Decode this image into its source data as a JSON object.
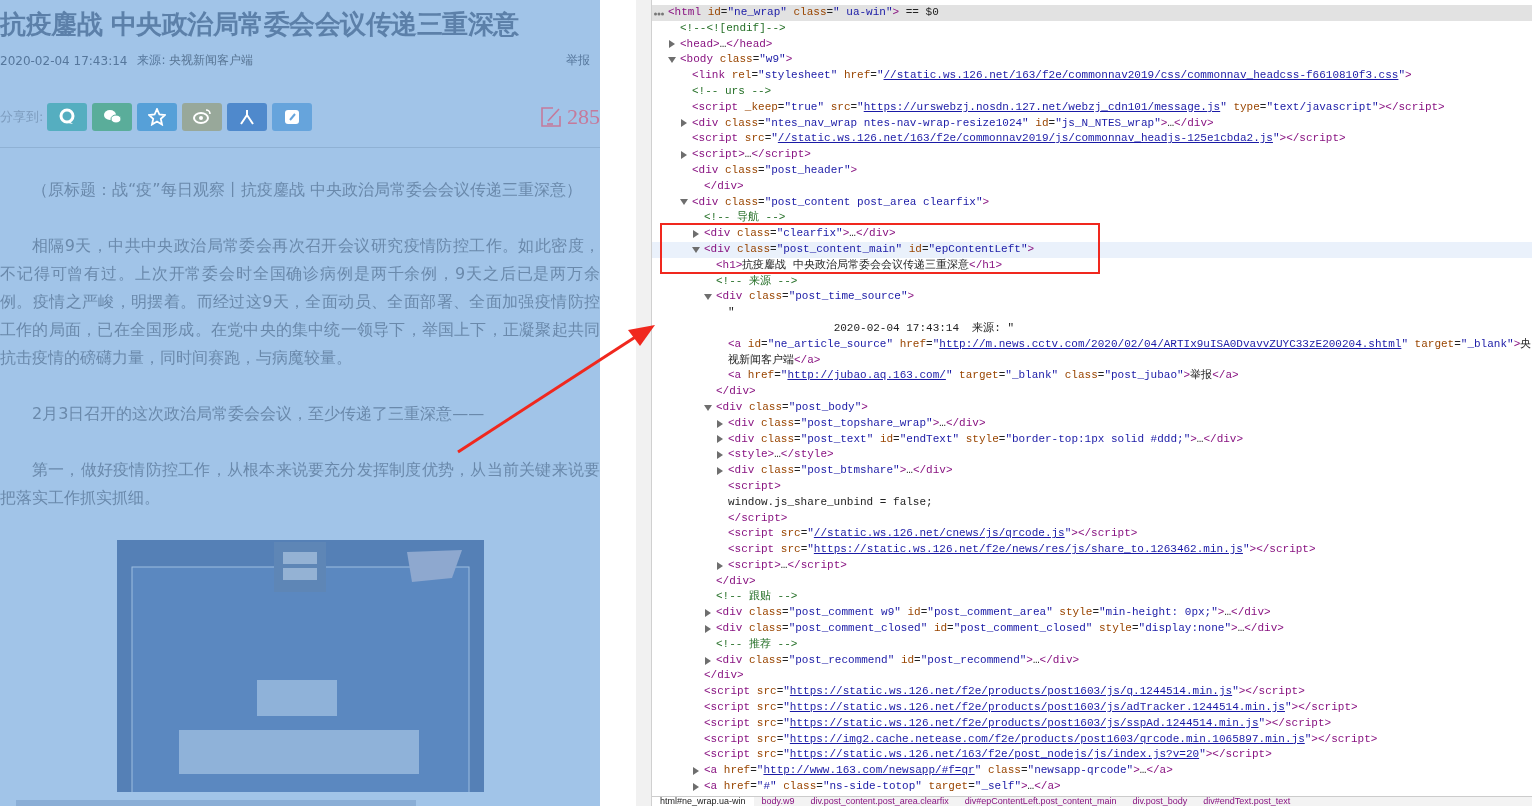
{
  "article": {
    "title": "抗疫鏖战 中央政治局常委会会议传递三重深意",
    "time": "2020-02-04 17:43:14",
    "source_label": "来源:",
    "source": "央视新闻客户端",
    "report": "举报",
    "share_label": "分享到:",
    "share_buttons": [
      {
        "kind": "qq",
        "color": "#55aec0"
      },
      {
        "kind": "wechat",
        "color": "#5aad9a"
      },
      {
        "kind": "qzone",
        "color": "#56a0d8"
      },
      {
        "kind": "weibo",
        "color": "#98a89a"
      },
      {
        "kind": "renren",
        "color": "#4f89cc"
      },
      {
        "kind": "note",
        "color": "#66a4dc"
      }
    ],
    "comment_count": "285",
    "paragraphs": [
      "（原标题：战“疫”每日观察丨抗疫鏖战 中央政治局常委会会议传递三重深意）",
      "相隔9天，中共中央政治局常委会再次召开会议研究疫情防控工作。如此密度，不记得可曾有过。上次开常委会时全国确诊病例是两千余例，9天之后已是两万余例。疫情之严峻，明摆着。而经过这9天，全面动员、全面部署、全面加强疫情防控工作的局面，已在全国形成。在党中央的集中统一领导下，举国上下，正凝聚起共同抗击疫情的磅礴力量，同时间赛跑，与病魔较量。",
      "2月3日召开的这次政治局常委会会议，至少传递了三重深意——",
      "第一，做好疫情防控工作，从根本来说要充分发挥制度优势，从当前关键来说要把落实工作抓实抓细。"
    ]
  },
  "devtools": {
    "tree": [
      {
        "line": "<html id=\"ne_wrap\" class=\" ua-win\"> == $0",
        "selected": true,
        "children": [
          {
            "line": "<!--<![endif]-->",
            "selected": false
          },
          {
            "line": "<head>…</head>",
            "selected": false,
            "expanded": false
          },
          {
            "line": "<body class=\"w9\">",
            "selected": false,
            "expanded": true,
            "children": [
              {
                "line": "<link rel=\"stylesheet\" href=\"//static.ws.126.net/163/f2e/commonnav2019/css/commonnav_headcss-f6610810f3.css\">",
                "selected": false
              },
              {
                "line": "<!-- urs -->",
                "selected": false
              },
              {
                "line": "<script _keep=\"true\" src=\"https://urswebzj.nosdn.127.net/webzj_cdn101/message.js\" type=\"text/javascript\"></script>",
                "selected": false
              },
              {
                "line": "<div class=\"ntes_nav_wrap ntes-nav-wrap-resize1024\" id=\"js_N_NTES_wrap\">…</div>",
                "selected": false,
                "expanded": false
              },
              {
                "line": "<script src=\"//static.ws.126.net/163/f2e/commonnav2019/js/commonnav_headjs-125e1cbda2.js\"></script>",
                "selected": false
              },
              {
                "line": "<script>…</script>",
                "selected": false,
                "expanded": false
              },
              {
                "line": "<div class=\"post_header\">",
                "selected": false,
                "children": [
                  {
                    "line": "</div>",
                    "selected": false
                  }
                ]
              },
              {
                "line": "<div class=\"post_content post_area clearfix\">",
                "selected": false,
                "expanded": true,
                "children": [
                  {
                    "line": "<!-- 导航 -->",
                    "selected": false
                  },
                  {
                    "line": "<div class=\"clearfix\">…</div>",
                    "selected": false,
                    "expanded": false
                  },
                  {
                    "line": "<div class=\"post_content_main\" id=\"epContentLeft\">",
                    "selected": false,
                    "hovered": true,
                    "expanded": true,
                    "close": "</div>",
                    "children": [
                      {
                        "line": "<h1>抗疫鏖战 中央政治局常委会会议传递三重深意</h1>",
                        "selected": false
                      },
                      {
                        "line": "<!-- 来源 -->",
                        "selected": false
                      },
                      {
                        "line": "<div class=\"post_time_source\">",
                        "selected": false,
                        "expanded": true,
                        "close": "</div>",
                        "children": [
                          {
                            "line": "\"\n                2020-02-04 17:43:14  来源: \"",
                            "selected": false
                          },
                          {
                            "line": "<a id=\"ne_article_source\" href=\"http://m.news.cctv.com/2020/02/04/ARTIx9uISA0DvavvZUYC33zE200204.shtml\" target=\"_blank\">央视新闻客户端</a>",
                            "selected": false
                          },
                          {
                            "line": "<a href=\"http://jubao.aq.163.com/\" target=\"_blank\" class=\"post_jubao\">举报</a>",
                            "selected": false
                          }
                        ]
                      },
                      {
                        "line": "<div class=\"post_body\">",
                        "selected": false,
                        "expanded": true,
                        "close": "</div>",
                        "children": [
                          {
                            "line": "<div class=\"post_topshare_wrap\">…</div>",
                            "selected": false,
                            "expanded": false
                          },
                          {
                            "line": "<div class=\"post_text\" id=\"endText\" style=\"border-top:1px solid #ddd;\">…</div>",
                            "selected": false,
                            "expanded": false
                          },
                          {
                            "line": "<style>…</style>",
                            "selected": false,
                            "expanded": false
                          },
                          {
                            "line": "<div class=\"post_btmshare\">…</div>",
                            "selected": false,
                            "expanded": false
                          },
                          {
                            "line": "<script>",
                            "selected": false
                          },
                          {
                            "line": "window.js_share_unbind = false;",
                            "selected": false
                          },
                          {
                            "line": "</script>",
                            "selected": false
                          },
                          {
                            "line": "<script src=\"//static.ws.126.net/cnews/js/qrcode.js\"></script>",
                            "selected": false
                          },
                          {
                            "line": "<script src=\"https://static.ws.126.net/f2e/news/res/js/share_to.1263462.min.js\"></script>",
                            "selected": false
                          },
                          {
                            "line": "<script>…</script>",
                            "selected": false,
                            "expanded": false
                          }
                        ]
                      },
                      {
                        "line": "<!-- 跟贴 -->",
                        "selected": false
                      },
                      {
                        "line": "<div class=\"post_comment w9\" id=\"post_comment_area\" style=\"min-height: 0px;\">…</div>",
                        "selected": false,
                        "expanded": false
                      },
                      {
                        "line": "<div class=\"post_comment_closed\" id=\"post_comment_closed\" style=\"display:none\">…</div>",
                        "selected": false,
                        "expanded": false
                      },
                      {
                        "line": "<!-- 推荐 -->",
                        "selected": false
                      },
                      {
                        "line": "<div class=\"post_recommend\" id=\"post_recommend\">…</div>",
                        "selected": false,
                        "expanded": false
                      }
                    ]
                  },
                  {
                    "line": "<script src=\"https://static.ws.126.net/f2e/products/post1603/js/q.1244514.min.js\"></script>",
                    "selected": false
                  },
                  {
                    "line": "<script src=\"https://static.ws.126.net/f2e/products/post1603/js/adTracker.1244514.min.js\"></script>",
                    "selected": false
                  },
                  {
                    "line": "<script src=\"https://static.ws.126.net/f2e/products/post1603/js/sspAd.1244514.min.js\"></script>",
                    "selected": false
                  },
                  {
                    "line": "<script src=\"https://img2.cache.netease.com/f2e/products/post1603/qrcode.min.1065897.min.js\"></script>",
                    "selected": false
                  },
                  {
                    "line": "<script src=\"https://static.ws.126.net/163/f2e/post_nodejs/js/index.js?v=20\"></script>",
                    "selected": false
                  },
                  {
                    "line": "<a href=\"http://www.163.com/newsapp/#f=qr\" class=\"newsapp-qrcode\">…</a>",
                    "selected": false,
                    "expanded": false
                  },
                  {
                    "line": "<a href=\"#\" class=\"ns-side-totop\" target=\"_self\">…</a>",
                    "selected": false,
                    "expanded": false
                  }
                ]
              }
            ]
          }
        ]
      }
    ],
    "breadcrumbs": [
      {
        "label": "html#ne_wrap.ua-win",
        "selected": true
      },
      {
        "label": "body.w9",
        "selected": false
      },
      {
        "label": "div.post_content.post_area.clearfix",
        "selected": false
      },
      {
        "label": "div#epContentLeft.post_content_main",
        "selected": false
      },
      {
        "label": "div.post_body",
        "selected": false
      },
      {
        "label": "div#endText.post_text",
        "selected": false
      }
    ]
  }
}
